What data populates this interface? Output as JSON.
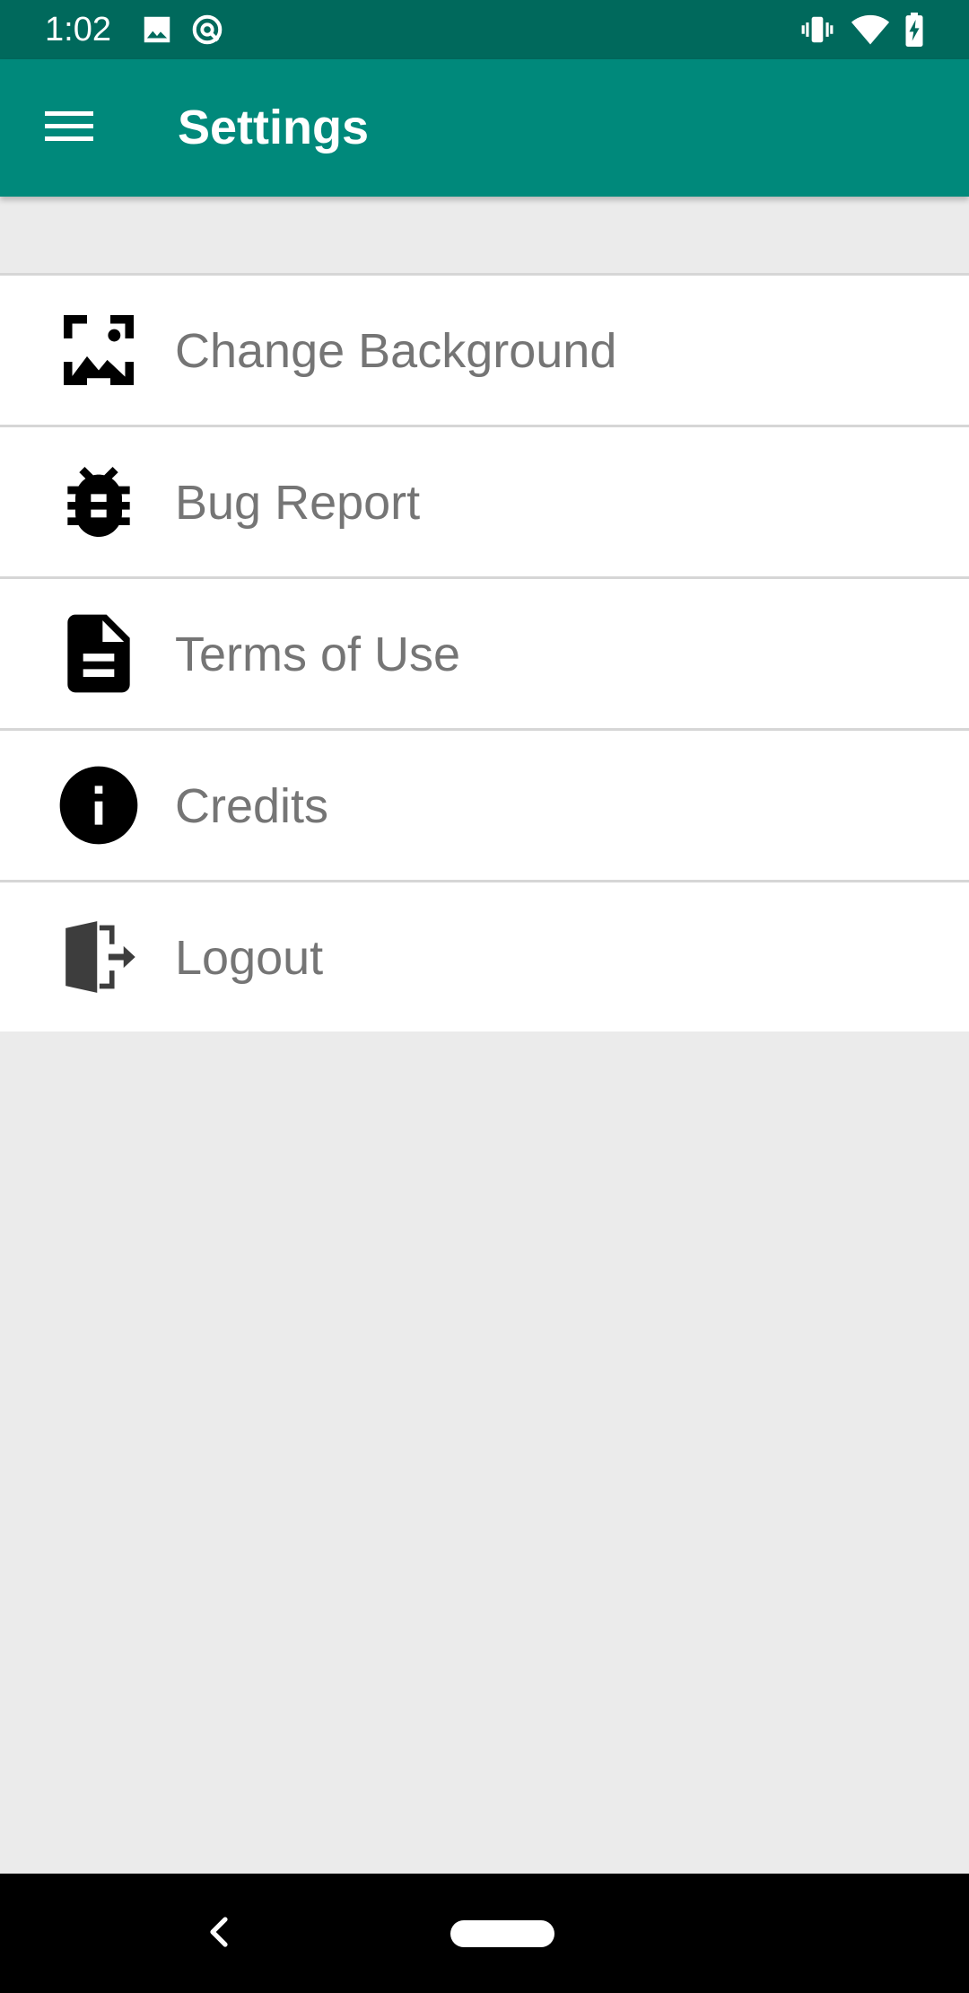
{
  "status_bar": {
    "time": "1:02",
    "left_icons": [
      "image-icon",
      "sync-icon"
    ],
    "right_icons": [
      "vibrate-icon",
      "wifi-icon",
      "battery-charging-icon"
    ]
  },
  "app_bar": {
    "title": "Settings",
    "menu_icon": "hamburger-menu-icon",
    "color": "#00897b",
    "status_color": "#00695c"
  },
  "settings": {
    "items": [
      {
        "label": "Change Background",
        "icon": "wallpaper-icon"
      },
      {
        "label": "Bug Report",
        "icon": "bug-icon"
      },
      {
        "label": "Terms of Use",
        "icon": "document-icon"
      },
      {
        "label": "Credits",
        "icon": "info-icon"
      },
      {
        "label": "Logout",
        "icon": "logout-door-icon"
      }
    ]
  },
  "nav_bar": {
    "back_icon": "back-chevron-icon",
    "home_icon": "home-pill-icon"
  }
}
